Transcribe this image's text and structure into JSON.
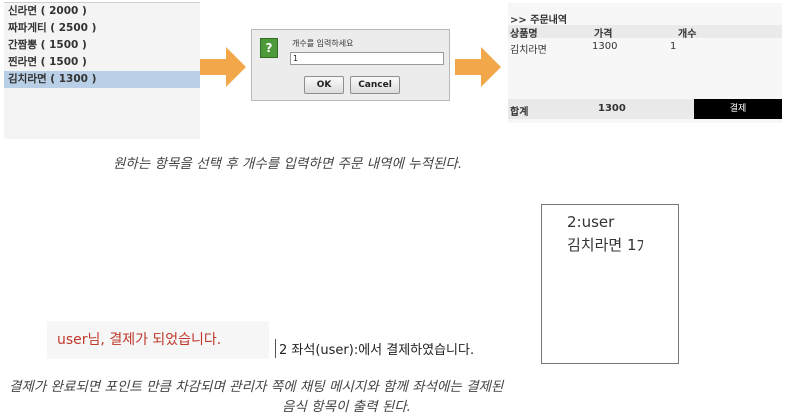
{
  "menu": {
    "items": [
      "신라면 ( 2000 )",
      "짜파게티 ( 2500 )",
      "간짬뽕 ( 1500 )",
      "찐라면 ( 1500 )",
      "김치라면 ( 1300 )"
    ],
    "selected_index": 4
  },
  "dialog": {
    "label": "개수를 입력하세요",
    "input_value": "1",
    "ok_label": "OK",
    "cancel_label": "Cancel",
    "icon": "question-icon"
  },
  "order": {
    "title": ">> 주문내역",
    "columns": [
      "상품명",
      "가격",
      "개수"
    ],
    "rows": [
      [
        "김치라면",
        "1300",
        "1"
      ]
    ],
    "total_label": "합계",
    "total_value": "1300",
    "pay_label": "결제"
  },
  "captions": {
    "top": "원하는 항목을 선택 후 개수를 입력하면 주문 내역에 누적된다.",
    "bottom_line1": "결제가 완료되면 포인트 만큼 차감되며 관리자 쪽에 채팅 메시지와 함께 좌석에는 결제된",
    "bottom_line2": "음식 항목이 출력 된다."
  },
  "seat": {
    "line1": "2:user",
    "line2": "김치라면 1ﾌ"
  },
  "messages": {
    "user_paid": "user님, 결제가 되었습니다.",
    "admin_chat": "2 좌석(user):에서 결제하였습니다."
  },
  "colors": {
    "selected_row": "#b9cfe6",
    "arrow": "#f2a84a",
    "pay_button": "#000000",
    "paid_message": "#c0392b"
  }
}
